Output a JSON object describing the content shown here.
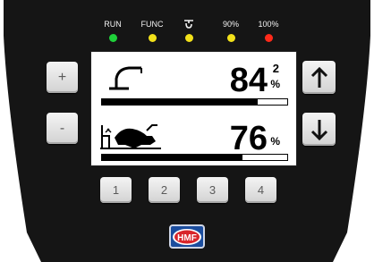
{
  "indicators": [
    {
      "label": "RUN",
      "color": "#1fd13a"
    },
    {
      "label": "FUNC",
      "color": "#f2e11a"
    },
    {
      "label": "",
      "icon": "hook-icon",
      "color": "#f2e11a"
    },
    {
      "label": "90%",
      "color": "#f2e11a"
    },
    {
      "label": "100%",
      "color": "#ff2a1a"
    }
  ],
  "buttons": {
    "plus": "+",
    "minus": "-",
    "up_icon": "arrow-up-icon",
    "down_icon": "arrow-down-icon",
    "numbers": [
      "1",
      "2",
      "3",
      "4"
    ]
  },
  "display": {
    "row1": {
      "icon": "crane-boom-icon",
      "value": "84",
      "superscript": "2",
      "unit": "%",
      "level": 0.84
    },
    "row2": {
      "icon": "stabilizer-leg-icon",
      "value": "76",
      "unit": "%",
      "level": 0.76
    }
  },
  "logo": {
    "text": "HMF",
    "color": "#1b4d9e"
  },
  "colors": {
    "panel": "#151515",
    "accent": "#1b4d9e"
  }
}
